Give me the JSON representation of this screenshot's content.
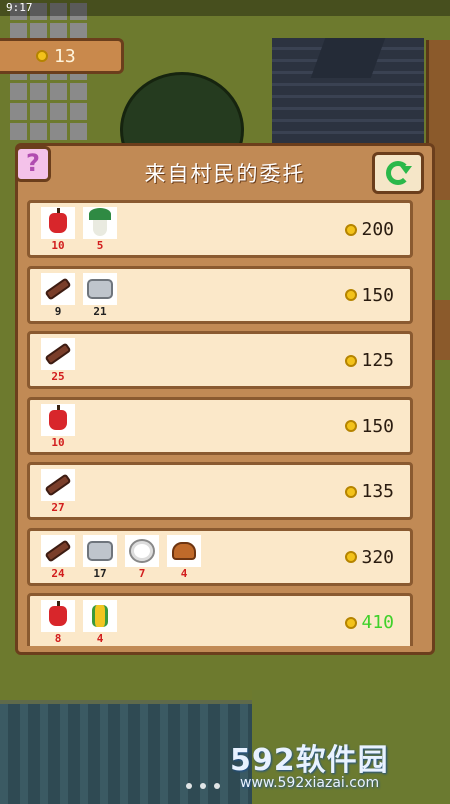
{
  "status": {
    "time": "9:17"
  },
  "coins": {
    "value": "13"
  },
  "panel": {
    "title": "来自村民的委托"
  },
  "colors": {
    "accent_green": "#2bb84a",
    "qty_red": "#d21e1e",
    "panel_brown": "#c18a55"
  },
  "requests": [
    {
      "items": [
        {
          "icon": "apple-icon",
          "qty": "10",
          "color": "red"
        },
        {
          "icon": "radish-icon",
          "qty": "5",
          "color": "red"
        }
      ],
      "reward": "200",
      "reward_color": "dark"
    },
    {
      "items": [
        {
          "icon": "wood-icon",
          "qty": "9",
          "color": "black"
        },
        {
          "icon": "stone-icon",
          "qty": "21",
          "color": "black"
        }
      ],
      "reward": "150",
      "reward_color": "dark"
    },
    {
      "items": [
        {
          "icon": "wood-icon",
          "qty": "25",
          "color": "red"
        }
      ],
      "reward": "125",
      "reward_color": "dark"
    },
    {
      "items": [
        {
          "icon": "apple-icon",
          "qty": "10",
          "color": "red"
        }
      ],
      "reward": "150",
      "reward_color": "dark"
    },
    {
      "items": [
        {
          "icon": "wood-icon",
          "qty": "27",
          "color": "red"
        }
      ],
      "reward": "135",
      "reward_color": "dark"
    },
    {
      "items": [
        {
          "icon": "wood-icon",
          "qty": "24",
          "color": "red"
        },
        {
          "icon": "stone-icon",
          "qty": "17",
          "color": "black"
        },
        {
          "icon": "cotton-icon",
          "qty": "7",
          "color": "red"
        },
        {
          "icon": "mushroom-icon",
          "qty": "4",
          "color": "red"
        }
      ],
      "reward": "320",
      "reward_color": "dark"
    },
    {
      "items": [
        {
          "icon": "apple-icon",
          "qty": "8",
          "color": "red"
        },
        {
          "icon": "corn-icon",
          "qty": "4",
          "color": "red"
        }
      ],
      "reward": "410",
      "reward_color": "green"
    }
  ],
  "watermark": {
    "big": "592软件园",
    "small": "www.592xiazai.com"
  }
}
